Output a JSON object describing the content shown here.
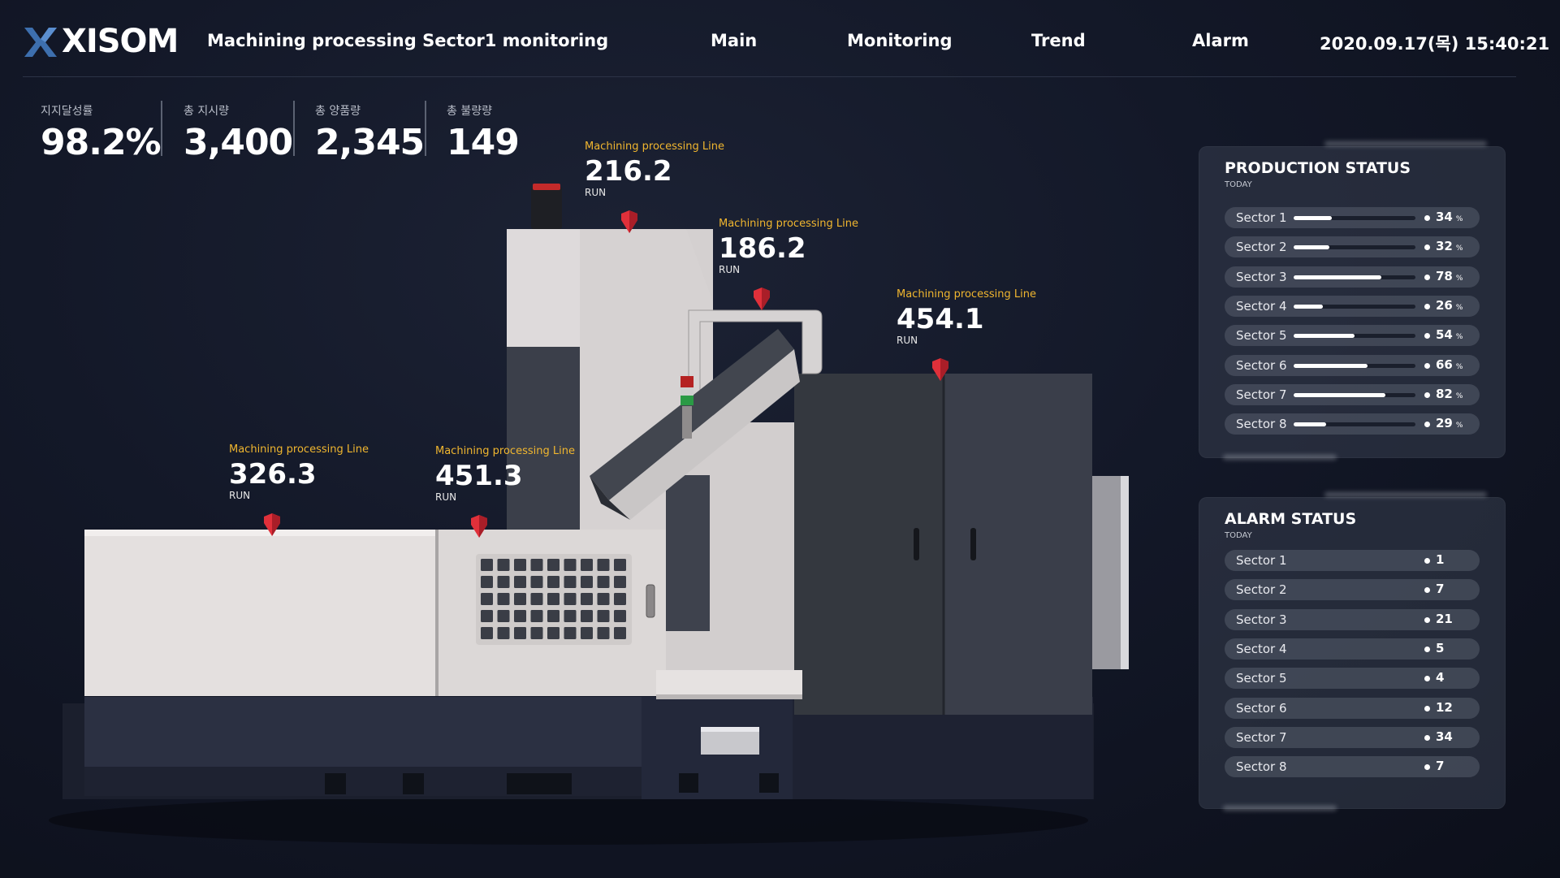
{
  "header": {
    "logo_text": "XISOM",
    "title": "Machining processing Sector1 monitoring",
    "nav": [
      "Main",
      "Monitoring",
      "Trend",
      "Alarm"
    ],
    "datetime": "2020.09.17(목)  15:40:21"
  },
  "kpis": [
    {
      "label": "지지달성률",
      "value": "98.2%"
    },
    {
      "label": "총 지시량",
      "value": "3,400"
    },
    {
      "label": "총 양품량",
      "value": "2,345"
    },
    {
      "label": "총 불량량",
      "value": "149"
    }
  ],
  "markers": [
    {
      "title": "Machining processing Line",
      "value": "216.2",
      "status": "RUN"
    },
    {
      "title": "Machining processing Line",
      "value": "186.2",
      "status": "RUN"
    },
    {
      "title": "Machining processing Line",
      "value": "454.1",
      "status": "RUN"
    },
    {
      "title": "Machining processing Line",
      "value": "326.3",
      "status": "RUN"
    },
    {
      "title": "Machining processing Line",
      "value": "451.3",
      "status": "RUN"
    }
  ],
  "production": {
    "title": "PRODUCTION STATUS",
    "subtitle": "TODAY",
    "unit": "%",
    "rows": [
      {
        "label": "Sector 1",
        "value": "34",
        "percent": 34
      },
      {
        "label": "Sector 2",
        "value": "32",
        "percent": 32
      },
      {
        "label": "Sector 3",
        "value": "78",
        "percent": 78
      },
      {
        "label": "Sector 4",
        "value": "26",
        "percent": 26
      },
      {
        "label": "Sector 5",
        "value": "54",
        "percent": 54
      },
      {
        "label": "Sector 6",
        "value": "66",
        "percent": 66
      },
      {
        "label": "Sector 7",
        "value": "82",
        "percent": 82
      },
      {
        "label": "Sector 8",
        "value": "29",
        "percent": 29
      }
    ]
  },
  "alarm": {
    "title": "ALARM STATUS",
    "subtitle": "TODAY",
    "rows": [
      {
        "label": "Sector 1",
        "value": "1"
      },
      {
        "label": "Sector 2",
        "value": "7"
      },
      {
        "label": "Sector 3",
        "value": "21"
      },
      {
        "label": "Sector 4",
        "value": "5"
      },
      {
        "label": "Sector 5",
        "value": "4"
      },
      {
        "label": "Sector 6",
        "value": "12"
      },
      {
        "label": "Sector 7",
        "value": "34"
      },
      {
        "label": "Sector 8",
        "value": "7"
      }
    ]
  },
  "colors": {
    "accent_text": "#f0b62f",
    "marker": "#e0303a",
    "logo_x": "#3d6fae"
  }
}
